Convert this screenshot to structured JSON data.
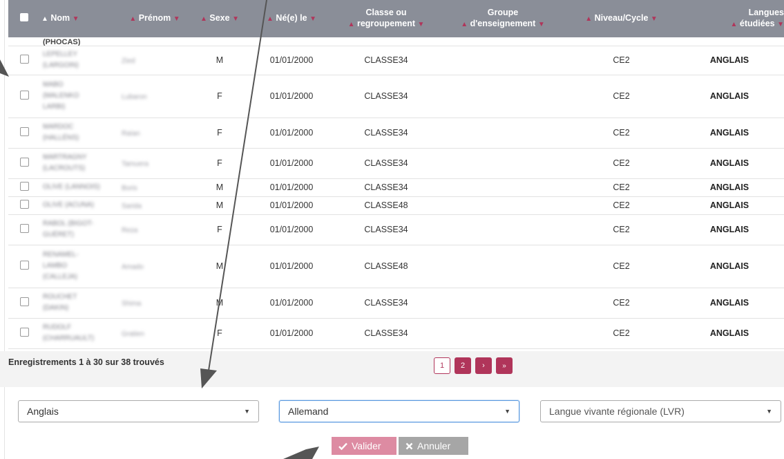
{
  "table": {
    "headers": {
      "nom": "Nom",
      "prenom": "Prénom",
      "sexe": "Sexe",
      "ne_le": "Né(e) le",
      "classe_l1": "Classe ou",
      "classe_l2": "regroupement",
      "groupe_l1": "Groupe",
      "groupe_l2": "d'enseignement",
      "niveau": "Niveau/Cycle",
      "langues_l1": "Langues",
      "langues_l2": "étudiées"
    },
    "partial_row_text": "(PHOCAS)",
    "rows": [
      {
        "nom": [
          "LEPELLEY",
          "(LARGOIN)"
        ],
        "prenom": "Zied",
        "sexe": "M",
        "date": "01/01/2000",
        "classe": "CLASSE34",
        "niveau": "CE2",
        "langue": "ANGLAIS"
      },
      {
        "nom": [
          "MABO",
          "(MALENKO",
          "LARBI)"
        ],
        "prenom": "Lubaron",
        "sexe": "F",
        "date": "01/01/2000",
        "classe": "CLASSE34",
        "niveau": "CE2",
        "langue": "ANGLAIS"
      },
      {
        "nom": [
          "MARDOC",
          "(HALLÉNS)"
        ],
        "prenom": "Raïan",
        "sexe": "F",
        "date": "01/01/2000",
        "classe": "CLASSE34",
        "niveau": "CE2",
        "langue": "ANGLAIS"
      },
      {
        "nom": [
          "MARTRAGNY",
          "(LACROUTS)"
        ],
        "prenom": "Tamuera",
        "sexe": "F",
        "date": "01/01/2000",
        "classe": "CLASSE34",
        "niveau": "CE2",
        "langue": "ANGLAIS"
      },
      {
        "nom": [
          "OLIVE (LANNOIS)"
        ],
        "prenom": "Boris",
        "sexe": "M",
        "date": "01/01/2000",
        "classe": "CLASSE34",
        "niveau": "CE2",
        "langue": "ANGLAIS"
      },
      {
        "nom": [
          "OLIVE (ACUNA)"
        ],
        "prenom": "Sarida",
        "sexe": "M",
        "date": "01/01/2000",
        "classe": "CLASSE48",
        "niveau": "CE2",
        "langue": "ANGLAIS"
      },
      {
        "nom": [
          "RABOL (BIGOT-",
          "GUÉRET)"
        ],
        "prenom": "Reza",
        "sexe": "F",
        "date": "01/01/2000",
        "classe": "CLASSE34",
        "niveau": "CE2",
        "langue": "ANGLAIS"
      },
      {
        "nom": [
          "RENAMEL-",
          "LAMBO",
          "(CALLEJA)"
        ],
        "prenom": "Amado",
        "sexe": "M",
        "date": "01/01/2000",
        "classe": "CLASSE48",
        "niveau": "CE2",
        "langue": "ANGLAIS"
      },
      {
        "nom": [
          "ROUCHET",
          "(DAKIN)"
        ],
        "prenom": "Shima",
        "sexe": "M",
        "date": "01/01/2000",
        "classe": "CLASSE34",
        "niveau": "CE2",
        "langue": "ANGLAIS"
      },
      {
        "nom": [
          "RUDOLF",
          "(CHARRUAULT)"
        ],
        "prenom": "Gratien",
        "sexe": "F",
        "date": "01/01/2000",
        "classe": "CLASSE34",
        "niveau": "CE2",
        "langue": "ANGLAIS"
      }
    ]
  },
  "footer": {
    "records_text": "Enregistrements 1 à 30 sur 38 trouvés",
    "pages": [
      "1",
      "2"
    ],
    "next_glyph": "›",
    "last_glyph": "»"
  },
  "language_selects": [
    {
      "value": "Anglais",
      "is_placeholder": false
    },
    {
      "value": "Allemand",
      "is_placeholder": false
    },
    {
      "value": "Langue vivante régionale (LVR)",
      "is_placeholder": true
    }
  ],
  "actions": {
    "valider_label": "Valider",
    "annuler_label": "Annuler"
  },
  "colors": {
    "accent": "#b0355a",
    "header_bg": "#8a8e98",
    "valider_bg": "#dd8ba2",
    "annuler_bg": "#a6a6a6",
    "annotation_arrow": "#555555"
  },
  "icons": {
    "valider": "check-icon",
    "annuler": "x-icon",
    "select_caret": "caret-down-icon",
    "sort_up": "sort-up-icon",
    "sort_down": "sort-down-icon"
  }
}
